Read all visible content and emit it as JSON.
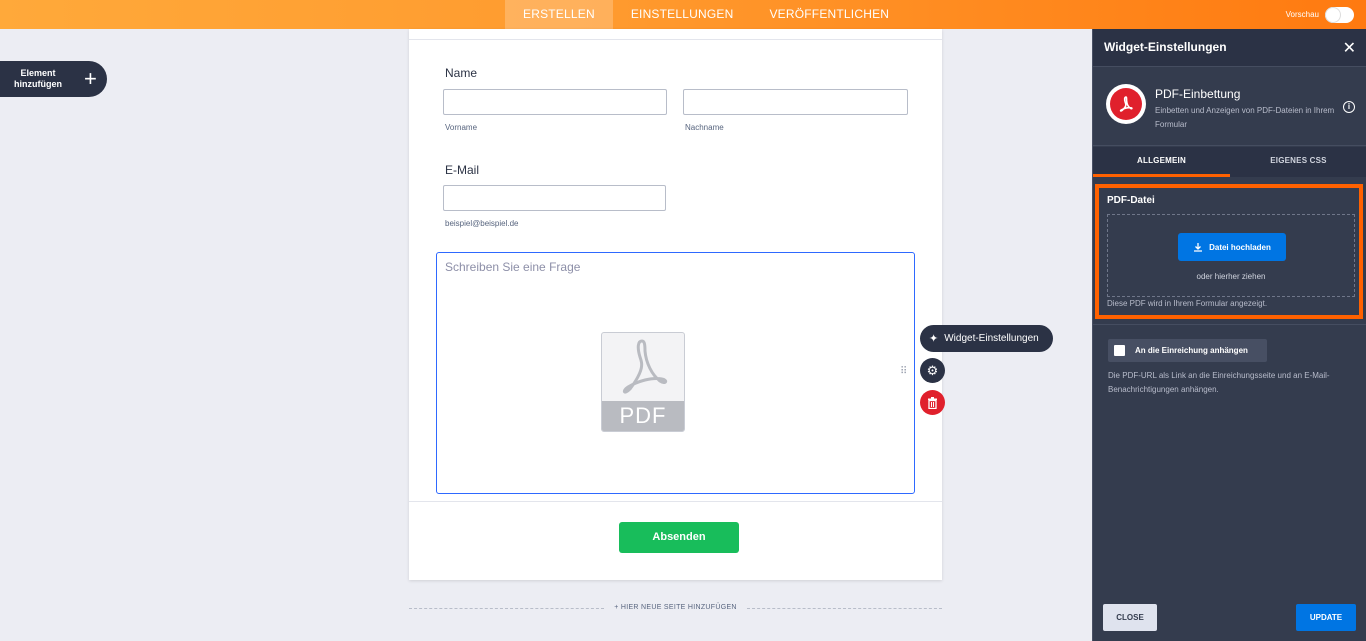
{
  "topbar": {
    "tabs": [
      {
        "label": "ERSTELLEN",
        "active": true
      },
      {
        "label": "EINSTELLUNGEN",
        "active": false
      },
      {
        "label": "VERÖFFENTLICHEN",
        "active": false
      }
    ],
    "preview_label": "Vorschau"
  },
  "sidebar": {
    "add_element_line1": "Element",
    "add_element_line2": "hinzufügen"
  },
  "form": {
    "name_label": "Name",
    "first_name_sublabel": "Vorname",
    "last_name_sublabel": "Nachname",
    "email_label": "E-Mail",
    "email_sublabel": "beispiel@beispiel.de",
    "pdf_question_placeholder": "Schreiben Sie eine Frage",
    "pdf_icon_text": "PDF",
    "submit_label": "Absenden",
    "new_page_label": "+ HIER NEUE SEITE HINZUFÜGEN"
  },
  "toolbar": {
    "widget_settings_label": "Widget-Einstellungen"
  },
  "panel": {
    "title": "Widget-Einstellungen",
    "widget_name": "PDF-Einbettung",
    "widget_description": "Einbetten und Anzeigen von PDF-Dateien in Ihrem Formular",
    "tabs": [
      {
        "label": "ALLGEMEIN",
        "active": true
      },
      {
        "label": "EIGENES CSS",
        "active": false
      }
    ],
    "pdf_file_label": "PDF-Datei",
    "upload_label": "Datei hochladen",
    "drag_label": "oder hierher ziehen",
    "pdf_hint": "Diese PDF wird in Ihrem Formular angezeigt.",
    "attach_label": "An die Einreichung anhängen",
    "attach_description": "Die PDF-URL als Link an die Einreichungsseite und an E-Mail-Benachrichtigungen anhängen.",
    "close_label": "CLOSE",
    "update_label": "UPDATE"
  },
  "colors": {
    "accent_orange": "#ff6100",
    "submit_green": "#18bd5b",
    "primary_blue": "#0075e3",
    "delete_red": "#e0202c",
    "panel_dark": "#343c4e"
  }
}
